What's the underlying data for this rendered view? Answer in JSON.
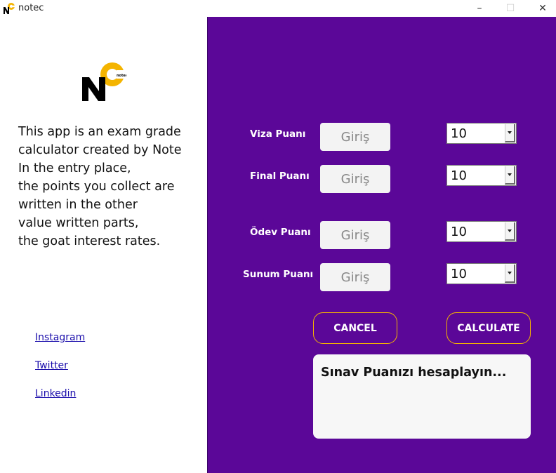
{
  "window": {
    "title": "notec",
    "minimize": "–",
    "maximize": "☐",
    "close": "✕"
  },
  "brand": {
    "icon": "notec-logo-icon",
    "logo_letters": "NC",
    "logo_small_text": "notec",
    "colors": {
      "yellow": "#f4b400",
      "black": "#000000"
    }
  },
  "about": {
    "lines": [
      "This app is an exam grade",
      "calculator created by Note",
      "In the entry place,",
      "the points you collect are",
      "written in the other",
      "value written parts,",
      "the goat interest rates."
    ]
  },
  "links": {
    "instagram": "Instagram",
    "twitter": "Twitter",
    "linkedin": "Linkedin"
  },
  "form": {
    "rows": [
      {
        "label": "Viza Puanı",
        "placeholder": "Giriş",
        "rate": "10"
      },
      {
        "label": "Final Puanı",
        "placeholder": "Giriş",
        "rate": "10"
      },
      {
        "label": "Ödev Puanı",
        "placeholder": "Giriş",
        "rate": "10"
      },
      {
        "label": "Sunum Puanı",
        "placeholder": "Giriş",
        "rate": "10"
      }
    ]
  },
  "buttons": {
    "cancel": "CANCEL",
    "calculate": "CALCULATE"
  },
  "result": {
    "text": "Sınav Puanızı hesaplayın..."
  },
  "colors": {
    "panel_bg": "#5b0798",
    "button_border": "#f4b400",
    "entry_bg": "#f3f3f3",
    "link": "#1a0dab"
  }
}
